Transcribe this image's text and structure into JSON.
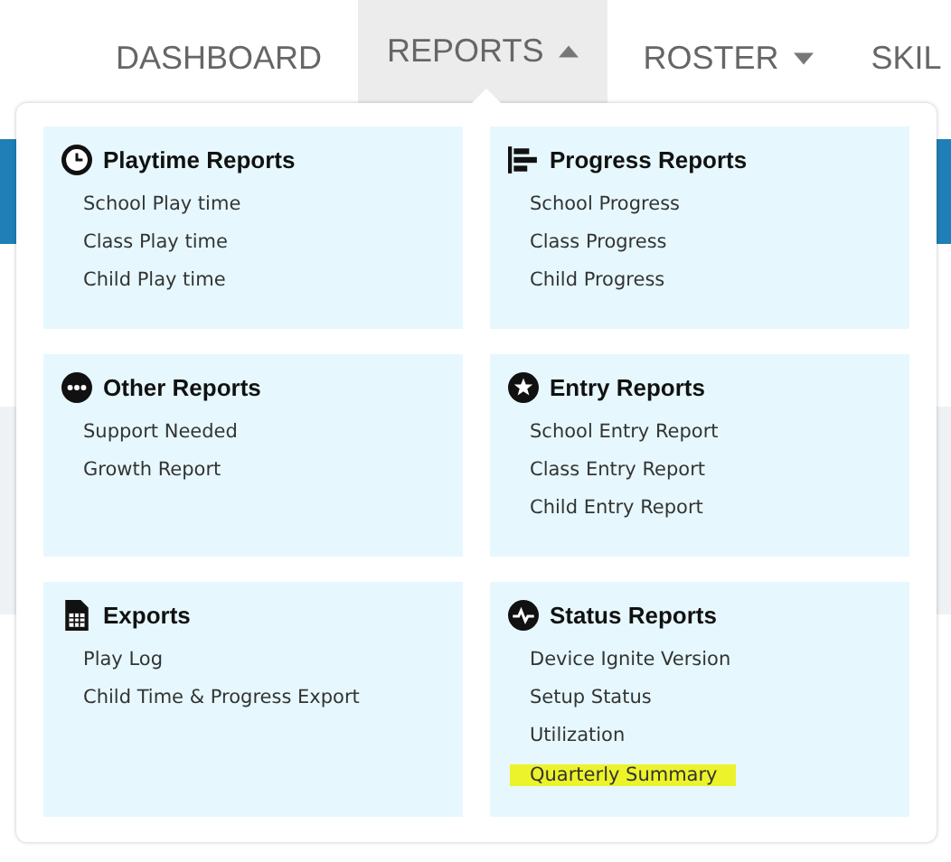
{
  "nav": [
    {
      "label": "DASHBOARD",
      "selected": false
    },
    {
      "label": "REPORTS",
      "expanded": true,
      "selected": true
    },
    {
      "label": "ROSTER",
      "expanded": false,
      "selected": false
    },
    {
      "label": "SKIL",
      "selected": false
    }
  ],
  "menu": {
    "sections": [
      {
        "title": "Playtime Reports",
        "kind": "clock",
        "items": [
          {
            "label": "School Play time",
            "highlighted": false
          },
          {
            "label": "Class Play time",
            "highlighted": false
          },
          {
            "label": "Child Play time",
            "highlighted": false
          }
        ]
      },
      {
        "title": "Progress Reports",
        "kind": "bars",
        "items": [
          {
            "label": "School Progress",
            "highlighted": false
          },
          {
            "label": "Class Progress",
            "highlighted": false
          },
          {
            "label": "Child Progress",
            "highlighted": false
          }
        ]
      },
      {
        "title": "Other Reports",
        "kind": "dots",
        "items": [
          {
            "label": "Support Needed",
            "highlighted": false
          },
          {
            "label": "Growth Report",
            "highlighted": false
          }
        ]
      },
      {
        "title": "Entry Reports",
        "kind": "star",
        "items": [
          {
            "label": "School Entry Report",
            "highlighted": false
          },
          {
            "label": "Class Entry Report",
            "highlighted": false
          },
          {
            "label": "Child Entry Report",
            "highlighted": false
          }
        ]
      },
      {
        "title": "Exports",
        "kind": "file",
        "items": [
          {
            "label": "Play Log",
            "highlighted": false
          },
          {
            "label": "Child Time & Progress Export",
            "highlighted": false
          }
        ]
      },
      {
        "title": "Status Reports",
        "kind": "pulse",
        "items": [
          {
            "label": "Device Ignite Version",
            "highlighted": false
          },
          {
            "label": "Setup Status",
            "highlighted": false
          },
          {
            "label": "Utilization",
            "highlighted": false
          },
          {
            "label": "Quarterly Summary",
            "highlighted": true
          }
        ]
      }
    ]
  }
}
